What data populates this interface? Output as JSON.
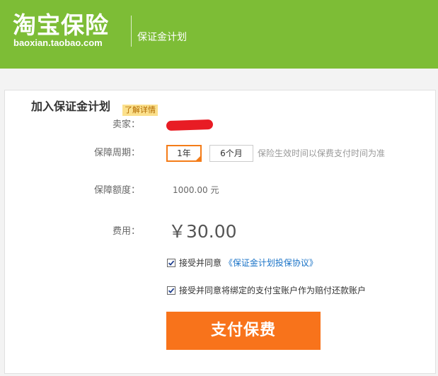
{
  "header": {
    "logo_text": "淘宝保险",
    "logo_url": "baoxian.taobao.com",
    "subtitle": "保证金计划"
  },
  "form": {
    "title": "加入保证金计划",
    "details_link": "了解详情",
    "seller_label": "卖家：",
    "period_label": "保障周期：",
    "period_options": [
      "1年",
      "6个月"
    ],
    "period_selected": "1年",
    "period_hint": "保险生效时间以保费支付时间为准",
    "coverage_label": "保障额度：",
    "coverage_value": "1000.00 元",
    "fee_label": "费用：",
    "fee_value": "￥30.00",
    "agree_prefix": "接受并同意",
    "agree_link": "《保证金计划投保协议》",
    "agree_account": "接受并同意将绑定的支付宝账户作为赔付还款账户",
    "pay_button": "支付保费"
  },
  "colors": {
    "header_green": "#7dbd36",
    "accent_orange": "#f8731b",
    "link_blue": "#1a73c7",
    "badge_yellow": "#fbe08c",
    "redaction_red": "#e81c24"
  }
}
